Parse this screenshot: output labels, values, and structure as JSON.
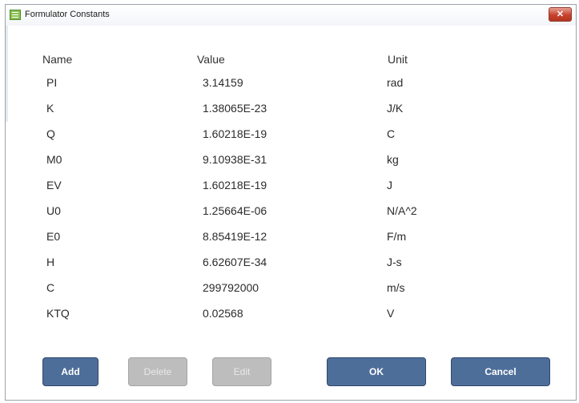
{
  "window": {
    "title": "Formulator Constants",
    "close_glyph": "✕",
    "icon": "app-icon"
  },
  "table": {
    "headers": {
      "name": "Name",
      "value": "Value",
      "unit": "Unit"
    },
    "rows": [
      {
        "name": "PI",
        "value": "3.14159",
        "unit": "rad"
      },
      {
        "name": "K",
        "value": "1.38065E-23",
        "unit": "J/K"
      },
      {
        "name": "Q",
        "value": "1.60218E-19",
        "unit": "C"
      },
      {
        "name": "M0",
        "value": "9.10938E-31",
        "unit": "kg"
      },
      {
        "name": "EV",
        "value": "1.60218E-19",
        "unit": "J"
      },
      {
        "name": "U0",
        "value": "1.25664E-06",
        "unit": "N/A^2"
      },
      {
        "name": "E0",
        "value": "8.85419E-12",
        "unit": "F/m"
      },
      {
        "name": "H",
        "value": "6.62607E-34",
        "unit": "J-s"
      },
      {
        "name": "C",
        "value": "299792000",
        "unit": "m/s"
      },
      {
        "name": "KTQ",
        "value": "0.02568",
        "unit": "V"
      }
    ]
  },
  "buttons": {
    "add": "Add",
    "delete": "Delete",
    "edit": "Edit",
    "ok": "OK",
    "cancel": "Cancel"
  },
  "colors": {
    "button": "#4e6e9a",
    "button_disabled": "#bdbdbd",
    "close": "#c7422d",
    "icon": "#8cc152"
  }
}
